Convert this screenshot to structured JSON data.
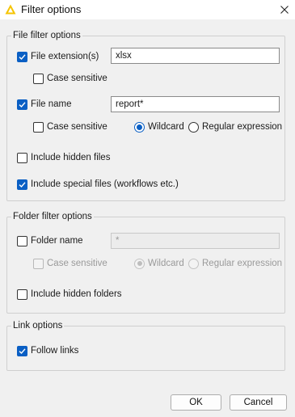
{
  "window": {
    "title": "Filter options",
    "close_icon": "close-icon",
    "app_icon": "warning-triangle-icon"
  },
  "colors": {
    "accent": "#0a5fc4",
    "app_icon": "#f5c400",
    "background": "#f0f0f0"
  },
  "file_filter": {
    "legend": "File filter options",
    "file_extension": {
      "label": "File extension(s)",
      "checked": true,
      "value": "xlsx"
    },
    "ext_case_sensitive": {
      "label": "Case sensitive",
      "checked": false
    },
    "file_name": {
      "label": "File name",
      "checked": true,
      "value": "report*"
    },
    "name_case_sensitive": {
      "label": "Case sensitive",
      "checked": false
    },
    "wildcard": {
      "label": "Wildcard",
      "selected": true
    },
    "regex": {
      "label": "Regular expression",
      "selected": false
    },
    "include_hidden": {
      "label": "Include hidden files",
      "checked": false
    },
    "include_special": {
      "label": "Include special files (workflows etc.)",
      "checked": true
    }
  },
  "folder_filter": {
    "legend": "Folder filter options",
    "folder_name": {
      "label": "Folder name",
      "checked": false,
      "value": "*"
    },
    "case_sensitive": {
      "label": "Case sensitive",
      "checked": false,
      "disabled": true
    },
    "wildcard": {
      "label": "Wildcard",
      "selected": true,
      "disabled": true
    },
    "regex": {
      "label": "Regular expression",
      "selected": false,
      "disabled": true
    },
    "include_hidden": {
      "label": "Include hidden folders",
      "checked": false
    }
  },
  "link_options": {
    "legend": "Link options",
    "follow_links": {
      "label": "Follow links",
      "checked": true
    }
  },
  "buttons": {
    "ok": "OK",
    "cancel": "Cancel"
  }
}
